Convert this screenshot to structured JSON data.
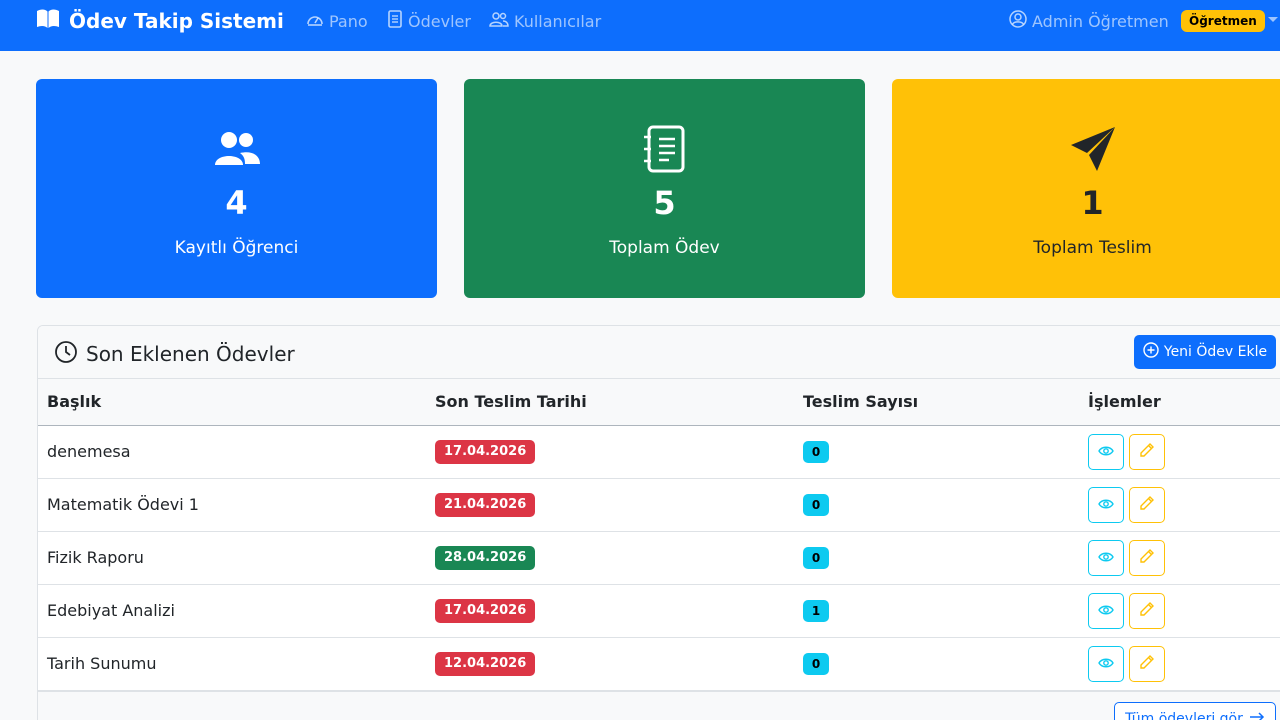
{
  "navbar": {
    "brand": "Ödev Takip Sistemi",
    "links": [
      "Pano",
      "Ödevler",
      "Kullanıcılar"
    ],
    "user": "Admin Öğretmen",
    "role": "Öğretmen"
  },
  "stats": [
    {
      "value": "4",
      "label": "Kayıtlı Öğrenci"
    },
    {
      "value": "5",
      "label": "Toplam Ödev"
    },
    {
      "value": "1",
      "label": "Toplam Teslim"
    }
  ],
  "recent": {
    "title": "Son Eklenen Ödevler",
    "add_button": "Yeni Ödev Ekle",
    "columns": [
      "Başlık",
      "Son Teslim Tarihi",
      "Teslim Sayısı",
      "İşlemler"
    ],
    "rows": [
      {
        "title": "denemesa",
        "due": "17.04.2026",
        "due_status": "overdue",
        "submissions": "0"
      },
      {
        "title": "Matematik Ödevi 1",
        "due": "21.04.2026",
        "due_status": "overdue",
        "submissions": "0"
      },
      {
        "title": "Fizik Raporu",
        "due": "28.04.2026",
        "due_status": "upcoming",
        "submissions": "0"
      },
      {
        "title": "Edebiyat Analizi",
        "due": "17.04.2026",
        "due_status": "overdue",
        "submissions": "1"
      },
      {
        "title": "Tarih Sunumu",
        "due": "12.04.2026",
        "due_status": "overdue",
        "submissions": "0"
      }
    ],
    "view_all": "Tüm ödevleri gör"
  },
  "colors": {
    "primary": "#0d6efd",
    "success": "#198754",
    "warning": "#ffc107",
    "danger": "#dc3545",
    "info": "#0dcaf0"
  },
  "icons": {
    "brand": "book-icon",
    "pano": "speedometer-icon",
    "odevler": "journal-icon",
    "kullanicilar": "people-icon",
    "user": "person-circle-icon",
    "students": "people-fill-icon",
    "homework": "journal-text-icon",
    "submissions": "send-icon",
    "recent": "clock-icon",
    "add": "plus-circle-icon",
    "view": "eye-icon",
    "edit": "pencil-icon",
    "view_all": "arrow-right-icon"
  }
}
